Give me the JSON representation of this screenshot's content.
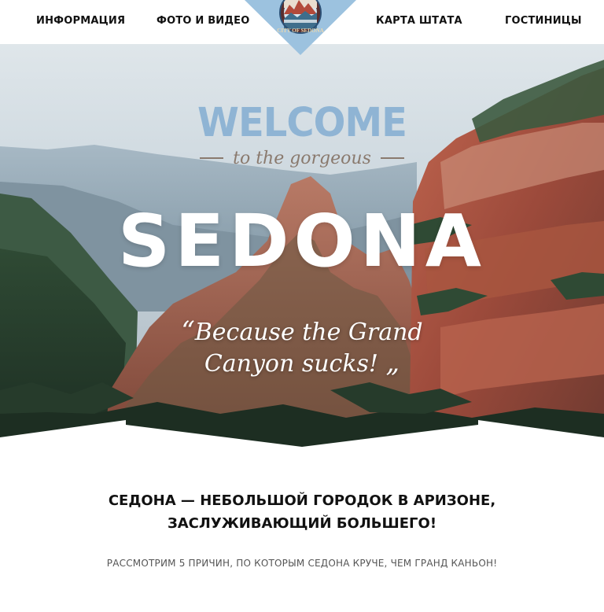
{
  "colors": {
    "accent_blue": "#8fb4d4",
    "logo_blue": "#9cc2df",
    "script_brown": "#8a7a6e",
    "text_dark": "#111111",
    "text_muted": "#555555"
  },
  "nav": {
    "items": [
      {
        "label": "ИНФОРМАЦИЯ"
      },
      {
        "label": "ФОТО И ВИДЕО"
      },
      {
        "label": "КАРТА ШТАТА"
      },
      {
        "label": "ГОСТИНИЦЫ"
      }
    ]
  },
  "logo": {
    "text": "CITY OF SEDONA"
  },
  "hero": {
    "welcome": "WELCOME",
    "subline": "to the gorgeous",
    "title": "SEDONA",
    "quote_line1": "Because the Grand",
    "quote_line2": "Canyon sucks!",
    "quote_open": "“",
    "quote_close": "„"
  },
  "content": {
    "title_line1": "СЕДОНА — НЕБОЛЬШОЙ ГОРОДОК В АРИЗОНЕ,",
    "title_line2": "ЗАСЛУЖИВАЮЩИЙ БОЛЬШЕГО!",
    "subtitle": "РАССМОТРИМ 5 ПРИЧИН, ПО КОТОРЫМ СЕДОНА КРУЧЕ, ЧЕМ ГРАНД КАНЬОН!"
  }
}
